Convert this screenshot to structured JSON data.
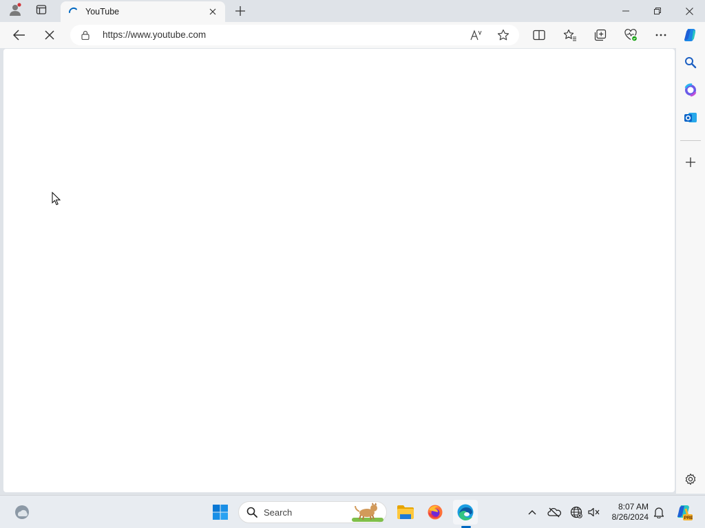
{
  "browser": {
    "tab": {
      "title": "YouTube"
    },
    "address_bar": {
      "url": "https://www.youtube.com"
    }
  },
  "taskbar": {
    "search_label": "Search",
    "clock": {
      "time": "8:07 AM",
      "date": "8/26/2024"
    }
  },
  "colors": {
    "accent": "#0067c0",
    "tab_active_bg": "#f7f7f7",
    "chrome_bg": "#dfe3e8",
    "page_bg": "#ffffff"
  },
  "icons": {
    "titlebar": [
      "profile-icon",
      "tab-actions-icon",
      "loading-spinner-icon",
      "close-icon",
      "plus-icon",
      "minimize-icon",
      "restore-icon",
      "close-icon"
    ],
    "toolbar": [
      "back-arrow-icon",
      "stop-icon",
      "lock-icon",
      "read-aloud-icon",
      "star-icon",
      "split-screen-icon",
      "favorites-icon",
      "collections-icon",
      "browser-essentials-icon",
      "more-icon",
      "copilot-icon"
    ],
    "sidebar": [
      "search-icon",
      "m365-icon",
      "outlook-icon",
      "plus-icon",
      "gear-icon"
    ],
    "taskbar": [
      "weather-icon",
      "windows-start-icon",
      "search-icon",
      "file-explorer-icon",
      "firefox-icon",
      "edge-icon",
      "chevron-up-icon",
      "onedrive-icon",
      "network-icon",
      "volume-icon",
      "bell-icon",
      "copilot-pre-icon"
    ]
  }
}
